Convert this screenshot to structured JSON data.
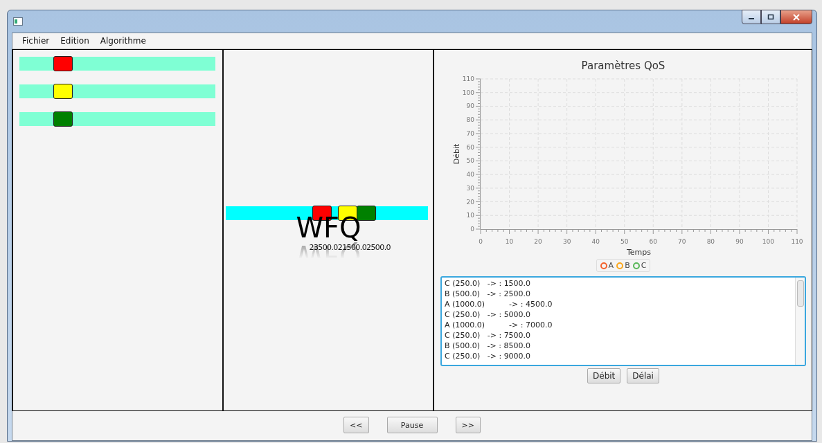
{
  "menu": [
    {
      "label": "Fichier"
    },
    {
      "label": "Edition"
    },
    {
      "label": "Algorithme"
    }
  ],
  "queues": [
    {
      "color": "#ff0000"
    },
    {
      "color": "#ffff00"
    },
    {
      "color": "#008000"
    }
  ],
  "scheduler": {
    "packets": [
      {
        "color": "#ff0000"
      },
      {
        "color": "#ffff00"
      },
      {
        "color": "#008000"
      }
    ],
    "label": "WFQ",
    "times": "23500.021500.02500.0"
  },
  "qos": {
    "chart_data": {
      "type": "line",
      "title": "Paramètres QoS",
      "xlabel": "Temps",
      "ylabel": "Débit",
      "ylim": [
        0,
        110
      ],
      "yticks": [
        0,
        10,
        20,
        30,
        40,
        50,
        60,
        70,
        80,
        90,
        100,
        110
      ],
      "grid": true,
      "categories": [
        "0",
        "10",
        "20",
        "30",
        "40",
        "50",
        "60",
        "70",
        "80",
        "90",
        "100",
        "110"
      ],
      "series": [
        {
          "name": "A",
          "color": "#f3622d",
          "values": [
            null,
            null,
            null,
            null,
            null,
            null,
            null,
            null,
            null,
            null,
            null,
            null
          ]
        },
        {
          "name": "B",
          "color": "#fba71b",
          "values": [
            null,
            null,
            null,
            null,
            null,
            null,
            null,
            null,
            null,
            null,
            null,
            null
          ]
        },
        {
          "name": "C",
          "color": "#57b757",
          "values": [
            null,
            null,
            null,
            null,
            null,
            null,
            null,
            null,
            null,
            null,
            null,
            null
          ]
        }
      ]
    },
    "log": [
      "C (250.0)   -> : 1500.0",
      "B (500.0)   -> : 2500.0",
      "A (1000.0)          -> : 4500.0",
      "C (250.0)   -> : 5000.0",
      "A (1000.0)          -> : 7000.0",
      "C (250.0)   -> : 7500.0",
      "B (500.0)   -> : 8500.0",
      "C (250.0)   -> : 9000.0"
    ],
    "buttons": [
      {
        "label": "Débit"
      },
      {
        "label": "Délai"
      }
    ]
  },
  "controls": [
    {
      "label": "<<"
    },
    {
      "label": "Pause"
    },
    {
      "label": ">>"
    }
  ]
}
